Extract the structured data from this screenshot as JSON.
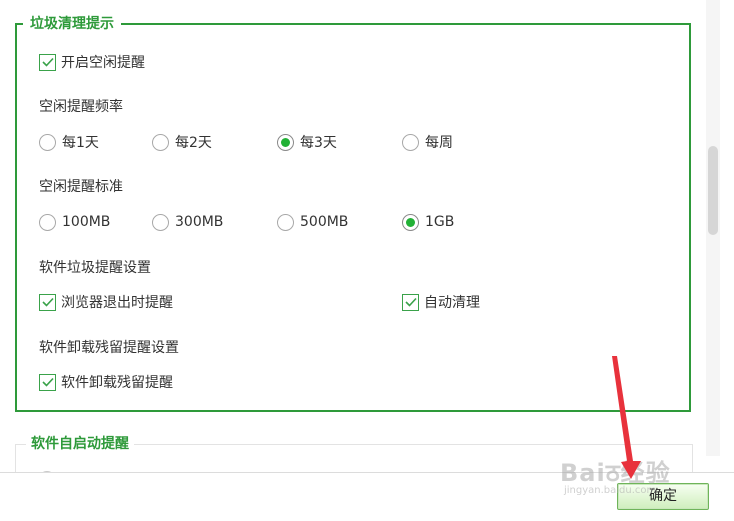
{
  "idle_cleanup_group": {
    "title": "垃圾清理提示",
    "enable_idle_reminder": {
      "label": "开启空闲提醒",
      "checked": true
    },
    "frequency": {
      "label": "空闲提醒频率",
      "options": [
        {
          "label": "每1天",
          "selected": false
        },
        {
          "label": "每2天",
          "selected": false
        },
        {
          "label": "每3天",
          "selected": true
        },
        {
          "label": "每周",
          "selected": false
        }
      ]
    },
    "standard": {
      "label": "空闲提醒标准",
      "options": [
        {
          "label": "100MB",
          "selected": false
        },
        {
          "label": "300MB",
          "selected": false
        },
        {
          "label": "500MB",
          "selected": false
        },
        {
          "label": "1GB",
          "selected": true
        }
      ]
    },
    "software_junk": {
      "label": "软件垃圾提醒设置",
      "browser_exit": {
        "label": "浏览器退出时提醒",
        "checked": true
      },
      "auto_clean": {
        "label": "自动清理",
        "checked": true
      }
    },
    "uninstall_residue": {
      "label": "软件卸载残留提醒设置",
      "reminder": {
        "label": "软件卸载残留提醒",
        "checked": true
      }
    }
  },
  "startup_group": {
    "title": "软件自启动提醒"
  },
  "footer": {
    "ok_label": "确定"
  },
  "watermark": {
    "main": "Baiठ经验",
    "sub": "jingyan.baidu.com"
  },
  "colors": {
    "accent": "#2e9a3a",
    "radio_dot": "#22b136",
    "annotation_arrow": "#e8323c"
  },
  "icons": {
    "checkbox_check": "check-icon",
    "radio_dot": "radio-dot-icon"
  }
}
